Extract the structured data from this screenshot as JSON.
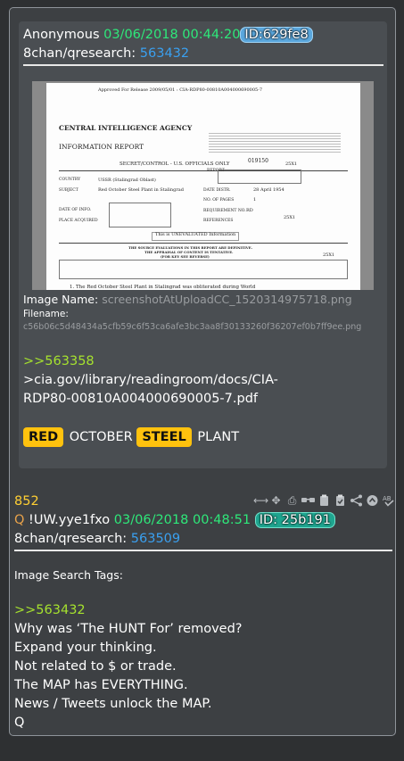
{
  "quoted_post": {
    "name": "Anonymous",
    "date": "03/06/2018 00:44:20",
    "id": "ID:629fe8",
    "board": "8chan/qresearch:",
    "post_no": "563432",
    "image_name_label": "Image Name:",
    "image_name": "screenshotAtUploadCC_1520314975718.png",
    "filename_label": "Filename:",
    "filename": "c56b06c5d48434a5cfb59c6f53ca6afe3bc3aa8f30133260f36207ef0b7ff9ee.png",
    "quote_link": ">>563358",
    "body_line1": ">cia.gov/library/readingroom/docs/CIA-",
    "body_line2": "RDP80-00810A004000690005-7.pdf",
    "hl1": "RED",
    "word1": "OCTOBER",
    "hl2": "STEEL",
    "word2": "PLANT"
  },
  "document": {
    "release": "Approved For Release 2009/05/01 : CIA-RDP80-00810A004000690005-7",
    "agency": "CENTRAL INTELLIGENCE AGENCY",
    "report": "INFORMATION REPORT",
    "classification": "SECRET/CONTROL - U.S. OFFICIALS ONLY",
    "report_label": "REPORT",
    "report_no": "019150",
    "code": "25X1",
    "country_label": "COUNTRY",
    "country": "USSR (Stalingrad Oblast)",
    "subject_label": "SUBJECT",
    "subject": "Red October Steel Plant in Stalingrad",
    "date_distr_label": "DATE DISTR.",
    "date_distr": "28 April 1954",
    "pages_label": "NO. OF PAGES",
    "pages": "1",
    "info_label": "DATE OF INFO.",
    "place_label": "PLACE ACQUIRED",
    "req_label": "REQUIREMENT NO.",
    "req": "RD",
    "ref_label": "REFERENCES",
    "code2": "25X1",
    "unevaluated": "This is UNEVALUATED Information",
    "note1": "THE SOURCE EVALUATIONS IN THIS REPORT ARE DEFINITIVE.",
    "note2": "THE APPRAISAL OF CONTENT IS TENTATIVE.",
    "note3": "(FOR KEY SEE REVERSE)",
    "code3": "25X1",
    "item": "1.  The Red October Steel Plant in Stalingrad was obliterated during World"
  },
  "main_post": {
    "number": "852",
    "q": "Q",
    "tripcode": "!UW.yye1fxo",
    "date": "03/06/2018 00:48:51",
    "id": "ID: 25b191",
    "board": "8chan/qresearch:",
    "post_no": "563509",
    "tags_label": "Image Search Tags:",
    "quote_link": ">>563432",
    "lines": [
      "Why was ‘The HUNT For’ removed?",
      "Expand your thinking.",
      "Not related to $ or trade.",
      "The MAP has EVERYTHING.",
      "News / Tweets unlock the MAP.",
      "Q"
    ]
  },
  "toolbar": {
    "icons": [
      "expand-horizontal-icon",
      "move-icon",
      "document-icon",
      "glasses-icon",
      "clipboard-icon",
      "clipboard-check-icon",
      "share-icon",
      "up-arrow-icon",
      "spellcheck-icon"
    ],
    "glyphs": [
      "⟷",
      "✥",
      "⎙",
      "■",
      "⎘",
      "✓",
      "➦",
      "▲",
      "ᴬ"
    ]
  },
  "colors": {
    "date": "#2ee87a",
    "link": "#3aa0f0",
    "quote": "#a6e22e",
    "highlight": "#ffc20e"
  }
}
